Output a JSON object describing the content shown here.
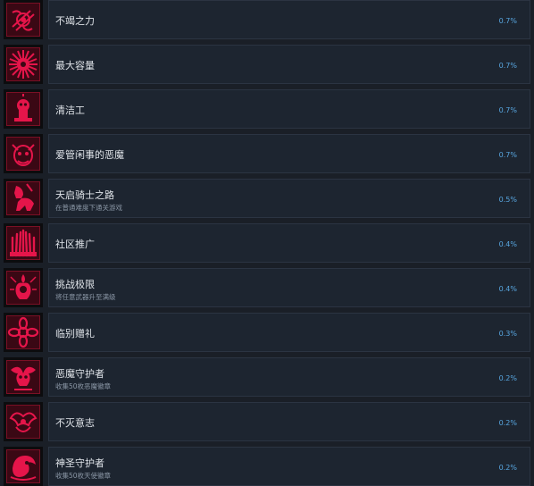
{
  "achievements": [
    {
      "title": "不竭之力",
      "desc": "",
      "percent": "0.7%",
      "icon": "sword-crest-icon"
    },
    {
      "title": "最大容量",
      "desc": "",
      "percent": "0.7%",
      "icon": "burst-icon"
    },
    {
      "title": "清洁工",
      "desc": "",
      "percent": "0.7%",
      "icon": "janitor-skull-icon"
    },
    {
      "title": "爱管闲事的恶魔",
      "desc": "",
      "percent": "0.7%",
      "icon": "demon-face-icon"
    },
    {
      "title": "天启骑士之路",
      "desc": "在普通难度下通关游戏",
      "percent": "0.5%",
      "icon": "knight-rider-icon"
    },
    {
      "title": "社区推广",
      "desc": "",
      "percent": "0.4%",
      "icon": "crowd-hands-icon"
    },
    {
      "title": "挑战极限",
      "desc": "将任意武器升至满级",
      "percent": "0.4%",
      "icon": "flame-figure-icon"
    },
    {
      "title": "临别赠礼",
      "desc": "",
      "percent": "0.3%",
      "icon": "gift-flower-icon"
    },
    {
      "title": "恶魔守护者",
      "desc": "收集50枚恶魔徽章",
      "percent": "0.2%",
      "icon": "demon-guardian-icon"
    },
    {
      "title": "不灭意志",
      "desc": "",
      "percent": "0.2%",
      "icon": "winged-will-icon"
    },
    {
      "title": "神圣守护者",
      "desc": "收集50枚天使徽章",
      "percent": "0.2%",
      "icon": "angel-guardian-icon"
    }
  ],
  "colors": {
    "page_bg": "#1a1f27",
    "panel_bg": "#1d2530",
    "icon_red": "#e5154a",
    "percent_blue": "#58a6e0"
  }
}
